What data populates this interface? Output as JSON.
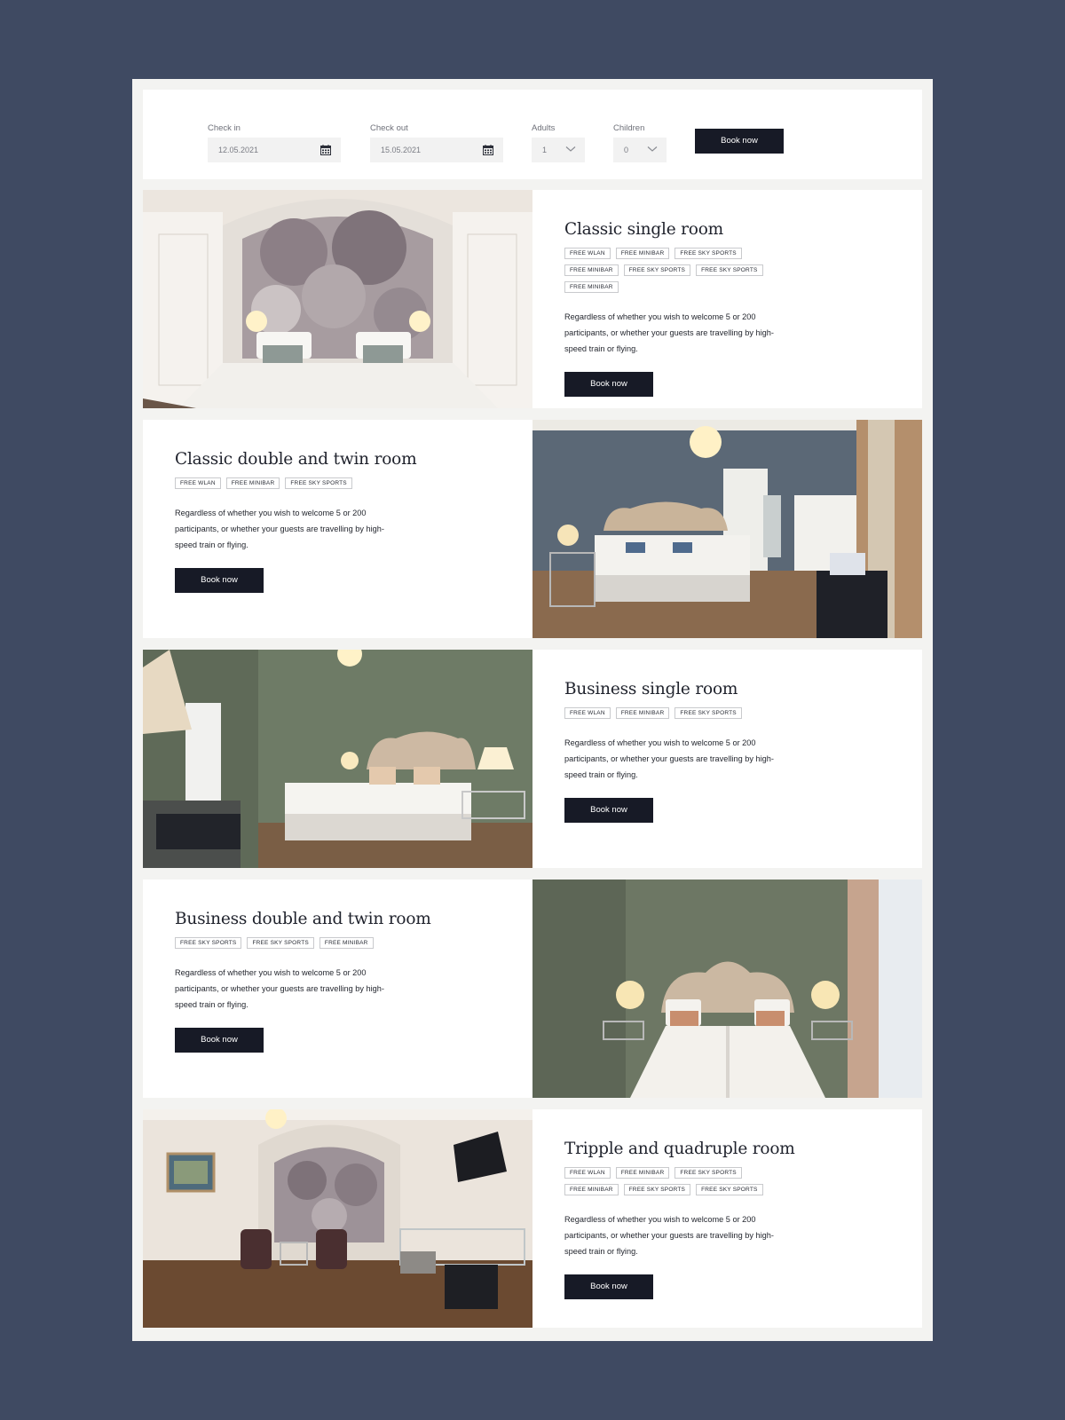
{
  "booking": {
    "check_in": {
      "label": "Check in",
      "value": "12.05.2021",
      "icon": "calendar-icon"
    },
    "check_out": {
      "label": "Check out",
      "value": "15.05.2021",
      "icon": "calendar-icon"
    },
    "adults": {
      "label": "Adults",
      "value": "1",
      "icon": "chevron-down-icon"
    },
    "children": {
      "label": "Children",
      "value": "0",
      "icon": "chevron-down-icon"
    },
    "book_label": "Book now"
  },
  "rooms": [
    {
      "title": "Classic single room",
      "tags": [
        "FREE WLAN",
        "FREE MINIBAR",
        "FREE SKY SPORTS",
        "FREE MINIBAR",
        "FREE SKY SPORTS",
        "FREE SKY SPORTS",
        "FREE MINIBAR"
      ],
      "description": "Regardless of whether you wish to welcome 5 or 200 participants, or whether your guests are travelling by high-speed train or flying.",
      "button": "Book now",
      "photo": "classic-single-room-photo"
    },
    {
      "title": "Classic double and twin room",
      "tags": [
        "FREE WLAN",
        "FREE MINIBAR",
        "FREE SKY SPORTS"
      ],
      "description": "Regardless of whether you wish to welcome 5 or 200 participants, or whether your guests are travelling by high-speed train or flying.",
      "button": "Book now",
      "photo": "classic-double-room-photo"
    },
    {
      "title": "Business single room",
      "tags": [
        "FREE WLAN",
        "FREE MINIBAR",
        "FREE SKY SPORTS"
      ],
      "description": "Regardless of whether you wish to welcome 5 or 200 participants, or whether your guests are travelling by high-speed train or flying.",
      "button": "Book now",
      "photo": "business-single-room-photo"
    },
    {
      "title": "Business double and twin room",
      "tags": [
        "FREE SKY SPORTS",
        "FREE SKY SPORTS",
        "FREE MINIBAR"
      ],
      "description": "Regardless of whether you wish to welcome 5 or 200 participants, or whether your guests are travelling by high-speed train or flying.",
      "button": "Book now",
      "photo": "business-double-room-photo"
    },
    {
      "title": "Tripple and quadruple room",
      "tags": [
        "FREE WLAN",
        "FREE MINIBAR",
        "FREE SKY SPORTS",
        "FREE MINIBAR",
        "FREE SKY SPORTS",
        "FREE SKY SPORTS"
      ],
      "description": "Regardless of whether you wish to welcome 5 or 200 participants, or whether your guests are travelling by high-speed train or flying.",
      "button": "Book now",
      "photo": "tripple-room-photo"
    }
  ],
  "colors": {
    "background": "#3f4a62",
    "frame": "#f3f3f1",
    "button": "#171a26",
    "wall_green": "#6e7b66",
    "wall_blue": "#5b6876"
  }
}
